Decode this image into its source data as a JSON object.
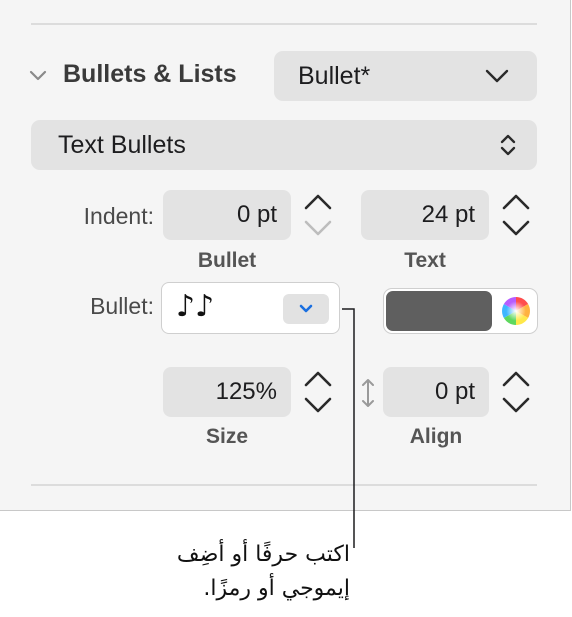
{
  "section": {
    "title": "Bullets & Lists",
    "preset_value": "Bullet*"
  },
  "bullet_type": {
    "value": "Text Bullets"
  },
  "indent": {
    "label": "Indent:",
    "bullet_value": "0 pt",
    "bullet_caption": "Bullet",
    "text_value": "24 pt",
    "text_caption": "Text"
  },
  "bullet": {
    "label": "Bullet:",
    "glyph": "♪♪",
    "color_swatch": "#5f5f5f"
  },
  "size": {
    "value": "125%",
    "caption": "Size"
  },
  "align": {
    "value": "0 pt",
    "caption": "Align"
  },
  "callout": {
    "line1": "اكتب حرفًا أو أضِف",
    "line2": "إيموجي أو رمزًا."
  },
  "colors": {
    "panel_bg": "#f5f5f5",
    "field_bg": "#e3e3e3",
    "accent_blue": "#1a6fe0",
    "swatch": "#5f5f5f"
  }
}
